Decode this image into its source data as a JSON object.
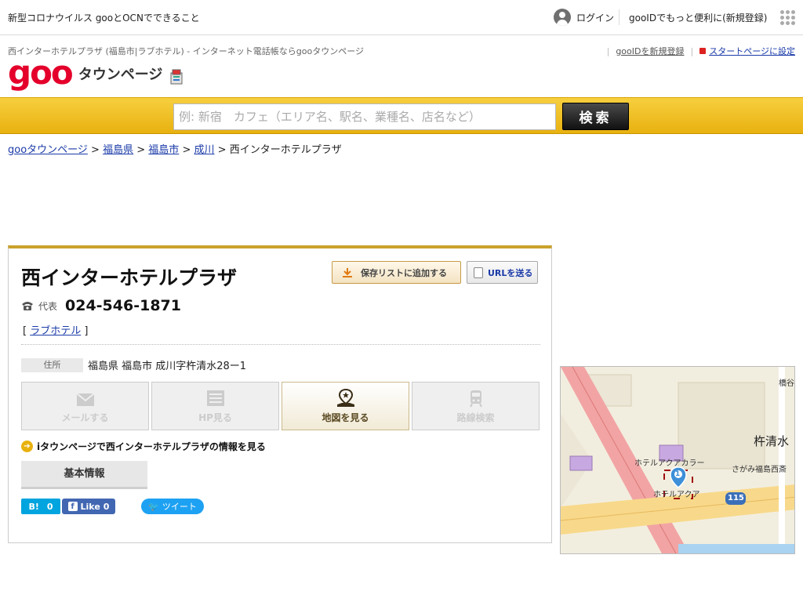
{
  "topbar": {
    "news": "新型コロナウイルス gooとOCNでできること",
    "login": "ログイン",
    "register": "gooIDでもっと便利に(新規登録)"
  },
  "header": {
    "description": "西インターホテルプラザ (福島市|ラブホテル) - インターネット電話帳ならgooタウンページ",
    "link_register": "gooIDを新規登録",
    "link_startpage": "スタートページに設定",
    "logo_goo": "goo",
    "logo_service": "タウンページ"
  },
  "search": {
    "placeholder": "例: 新宿　カフェ（エリア名、駅名、業種名、店名など）",
    "button": "検索"
  },
  "breadcrumb": {
    "items": [
      "gooタウンページ",
      "福島県",
      "福島市",
      "成川"
    ],
    "sep": ">",
    "current": "西インターホテルプラザ"
  },
  "business": {
    "name": "西インターホテルプラザ",
    "save_button": "保存リストに追加する",
    "url_button": "URLを送る",
    "phone_label": "代表",
    "phone": "024-546-1871",
    "category": "ラブホテル",
    "address_label": "住所",
    "address": "福島県 福島市 成川字杵清水28ー1"
  },
  "actions": [
    {
      "label": "メールする",
      "icon": "mail-icon"
    },
    {
      "label": "HP見る",
      "icon": "webpage-icon"
    },
    {
      "label": "地図を見る",
      "icon": "map-pin-icon"
    },
    {
      "label": "路線検索",
      "icon": "train-icon"
    }
  ],
  "imode_link": "iタウンページで西インターホテルプラザの情報を見る",
  "tab_basic": "基本情報",
  "social": {
    "hatena_count": "0",
    "fb_like": "Like",
    "fb_count": "0",
    "tweet": "ツイート"
  },
  "map": {
    "labels": [
      "橋谷",
      "杵清水",
      "ホテルアクアカラー",
      "さがみ福島西斎",
      "ホテルアクア",
      "115"
    ],
    "marker_number": "1"
  },
  "colors": {
    "accent_yellow": "#e8b10f",
    "goo_red": "#e4002b",
    "link_blue": "#1a3aa8"
  }
}
